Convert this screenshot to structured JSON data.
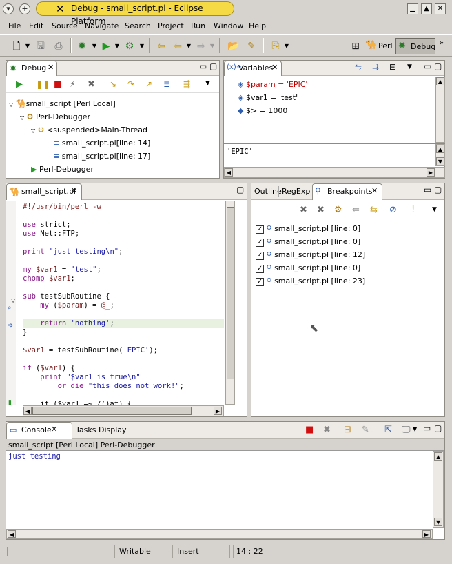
{
  "window": {
    "title": "Debug - small_script.pl - Eclipse Platform"
  },
  "menu": [
    "File",
    "Edit",
    "Source",
    "Navigate",
    "Search",
    "Project",
    "Run",
    "Window",
    "Help"
  ],
  "perspectives": {
    "perl": "Perl",
    "debug": "Debug"
  },
  "debug_view": {
    "tab": "Debug",
    "tree": [
      {
        "label": "small_script [Perl Local]",
        "icon": "camel-icon"
      },
      {
        "label": "Perl-Debugger",
        "icon": "debugger-icon"
      },
      {
        "label": "<suspended>Main-Thread",
        "icon": "thread-icon"
      },
      {
        "label": "small_script.pl[line: 14]",
        "icon": "stack-frame-icon"
      },
      {
        "label": "small_script.pl[line: 17]",
        "icon": "stack-frame-icon"
      },
      {
        "label": "Perl-Debugger",
        "icon": "process-icon"
      }
    ]
  },
  "variables_view": {
    "tab": "Variables",
    "items": [
      {
        "label": "$param = 'EPIC'",
        "color": "#c00000"
      },
      {
        "label": "$var1 = 'test'",
        "color": "#000000"
      },
      {
        "label": "$> = 1000",
        "color": "#000000"
      }
    ],
    "detail": "'EPIC'"
  },
  "editor": {
    "tab": "small_script.pl",
    "lines": [
      [
        {
          "t": "#!/usr/bin/perl -w",
          "c": "var"
        }
      ],
      [],
      [
        {
          "t": "use",
          "c": "kw"
        },
        {
          "t": " strict;",
          "c": ""
        }
      ],
      [
        {
          "t": "use",
          "c": "kw"
        },
        {
          "t": " Net::FTP;",
          "c": ""
        }
      ],
      [],
      [
        {
          "t": "print",
          "c": "kw"
        },
        {
          "t": " ",
          "c": ""
        },
        {
          "t": "\"just testing\\n\"",
          "c": "str"
        },
        {
          "t": ";",
          "c": ""
        }
      ],
      [],
      [
        {
          "t": "my",
          "c": "kw"
        },
        {
          "t": " ",
          "c": ""
        },
        {
          "t": "$var1",
          "c": "var"
        },
        {
          "t": " = ",
          "c": ""
        },
        {
          "t": "\"test\"",
          "c": "str"
        },
        {
          "t": ";",
          "c": ""
        }
      ],
      [
        {
          "t": "chomp",
          "c": "kw"
        },
        {
          "t": " ",
          "c": ""
        },
        {
          "t": "$var1",
          "c": "var"
        },
        {
          "t": ";",
          "c": ""
        }
      ],
      [],
      [
        {
          "t": "sub",
          "c": "kw"
        },
        {
          "t": " testSubRoutine {",
          "c": ""
        }
      ],
      [
        {
          "t": "    my",
          "c": "kw"
        },
        {
          "t": " (",
          "c": ""
        },
        {
          "t": "$param",
          "c": "var"
        },
        {
          "t": ") = ",
          "c": ""
        },
        {
          "t": "@_",
          "c": "var"
        },
        {
          "t": ";",
          "c": ""
        }
      ],
      [],
      [
        {
          "t": "    return",
          "c": "kw"
        },
        {
          "t": " ",
          "c": ""
        },
        {
          "t": "'nothing'",
          "c": "str"
        },
        {
          "t": ";",
          "c": ""
        }
      ],
      [
        {
          "t": "}",
          "c": ""
        }
      ],
      [],
      [
        {
          "t": "$var1",
          "c": "var"
        },
        {
          "t": " = testSubRoutine(",
          "c": ""
        },
        {
          "t": "'EPIC'",
          "c": "str"
        },
        {
          "t": ");",
          "c": ""
        }
      ],
      [],
      [
        {
          "t": "if",
          "c": "kw"
        },
        {
          "t": " (",
          "c": ""
        },
        {
          "t": "$var1",
          "c": "var"
        },
        {
          "t": ") {",
          "c": ""
        }
      ],
      [
        {
          "t": "    print",
          "c": "kw"
        },
        {
          "t": " ",
          "c": ""
        },
        {
          "t": "\"$var1 is true\\n\"",
          "c": "str"
        }
      ],
      [
        {
          "t": "        or die",
          "c": "kw"
        },
        {
          "t": " ",
          "c": ""
        },
        {
          "t": "\"this does not work!\"",
          "c": "str"
        },
        {
          "t": ";",
          "c": ""
        }
      ],
      [],
      [
        {
          "t": "    if ($var1 =~ /()at) {",
          "c": ""
        }
      ]
    ]
  },
  "right_tabs": {
    "outline": "Outline",
    "regexp": "RegExp",
    "breakpoints": "Breakpoints"
  },
  "breakpoints": [
    {
      "label": "small_script.pl [line: 0]",
      "icon": "line-breakpoint-icon"
    },
    {
      "label": "small_script.pl [line: 0]",
      "icon": "line-breakpoint-icon"
    },
    {
      "label": "small_script.pl [line: 12]",
      "icon": "line-breakpoint-icon"
    },
    {
      "label": "small_script.pl [line: 0]",
      "icon": "regexp-breakpoint-icon"
    },
    {
      "label": "small_script.pl [line: 23]",
      "icon": "regexp-breakpoint-icon"
    }
  ],
  "console": {
    "tabs": {
      "console": "Console",
      "tasks": "Tasks",
      "display": "Display"
    },
    "process": "small_script [Perl Local] Perl-Debugger",
    "output": "just testing"
  },
  "status": {
    "writable": "Writable",
    "insert": "Insert",
    "position": "14 : 22"
  }
}
